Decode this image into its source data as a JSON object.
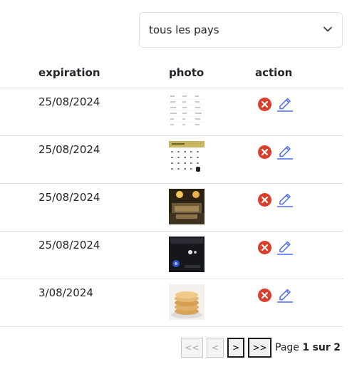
{
  "filter": {
    "country_select_value": "tous les pays"
  },
  "table": {
    "headers": {
      "expiration": "expiration",
      "photo": "photo",
      "action": "action"
    },
    "rows": [
      {
        "expiration": "25/08/2024",
        "photo": "table-screenshot-thumbnail"
      },
      {
        "expiration": "25/08/2024",
        "photo": "calendar-screenshot-thumbnail"
      },
      {
        "expiration": "25/08/2024",
        "photo": "hotel-room-thumbnail"
      },
      {
        "expiration": "25/08/2024",
        "photo": "dark-lamp-thumbnail"
      },
      {
        "expiration": "3/08/2024",
        "photo": "pancakes-thumbnail"
      }
    ]
  },
  "pagination": {
    "first_label": "<<",
    "prev_label": "<",
    "next_label": ">",
    "last_label": ">>",
    "page_word": "Page",
    "current_page": "1",
    "of_word": "sur",
    "total_pages": "2"
  },
  "colors": {
    "delete": "#dc3d2a",
    "edit": "#4a6cf7",
    "border": "#dee2e6"
  }
}
